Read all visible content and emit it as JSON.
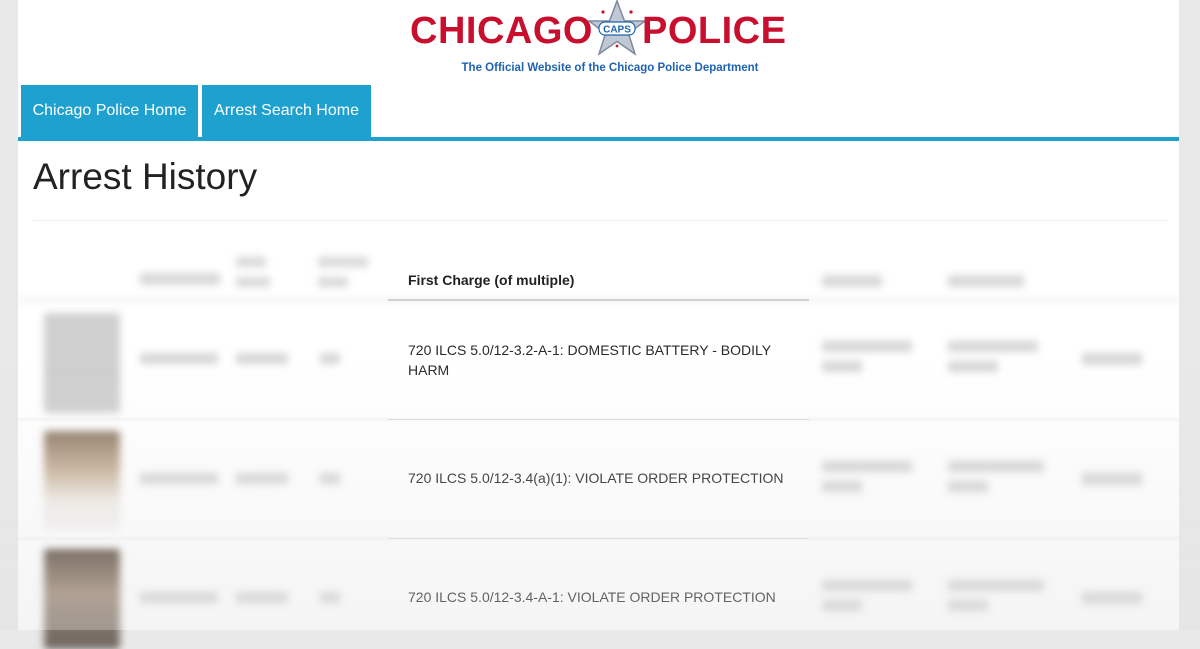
{
  "header": {
    "logo_word_left": "CHICAGO",
    "logo_word_right": "POLICE",
    "logo_badge": "CAPS",
    "tagline": "The Official Website of the Chicago Police Department"
  },
  "nav": {
    "tabs": [
      {
        "label": "Chicago Police Home"
      },
      {
        "label": "Arrest Search Home"
      }
    ]
  },
  "page_title": "Arrest History",
  "table": {
    "visible_header": "First Charge (of multiple)",
    "rows": [
      {
        "first_charge": "720 ILCS 5.0/12-3.2-A-1: DOMESTIC BATTERY - BODILY HARM"
      },
      {
        "first_charge": "720 ILCS 5.0/12-3.4(a)(1): VIOLATE ORDER PROTECTION"
      },
      {
        "first_charge": "720 ILCS 5.0/12-3.4-A-1: VIOLATE ORDER PROTECTION"
      }
    ]
  },
  "colors": {
    "brand_red": "#c8102e",
    "brand_blue": "#1f63b0",
    "nav_accent": "#1fa1cf"
  },
  "icons": [
    "caps-star-logo"
  ]
}
